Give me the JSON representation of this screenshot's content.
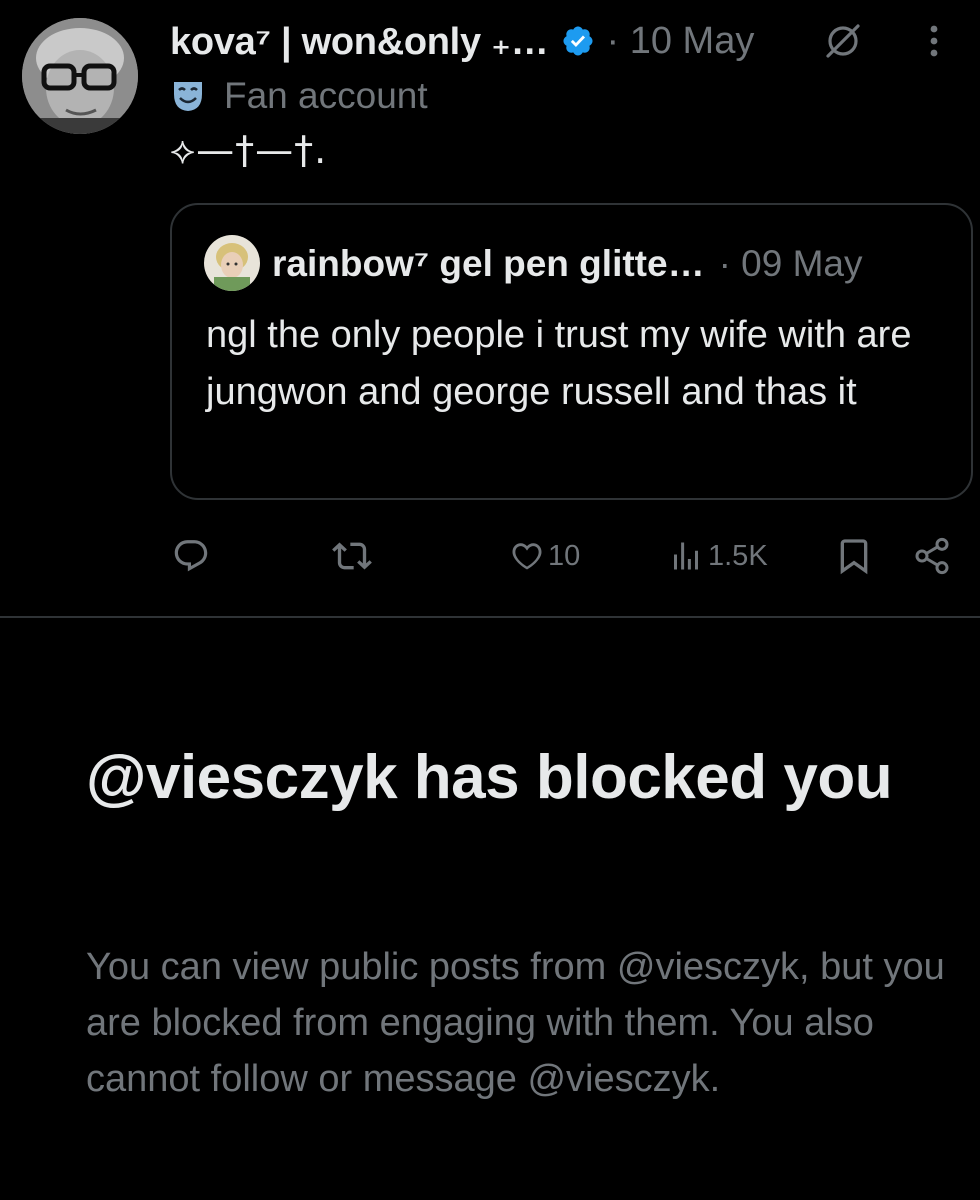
{
  "post": {
    "author_name": "kova⁷ | won&only ₊…",
    "post_time": "· 10 May",
    "label": "Fan account",
    "text": "⟡—†—†.",
    "quote": {
      "author_name": "rainbow⁷ gel pen glitte…",
      "post_time": "· 09 May",
      "text": "ngl the only people i trust my wife with are jungwon and george russell and thas it"
    },
    "actions": {
      "reply_icon": "reply-icon",
      "repost_icon": "repost-icon",
      "like_icon": "heart-icon",
      "like_count": "10",
      "views_icon": "views-icon",
      "view_count": "1.5K",
      "bookmark_icon": "bookmark-icon",
      "share_icon": "share-icon"
    }
  },
  "blocked": {
    "title": "@viesczyk has blocked you",
    "body": "You can view public posts from @viesczyk, but you are blocked from engaging with them. You also cannot follow or message @viesczyk."
  },
  "colors": {
    "background": "#000000",
    "primary_text": "#e7e9ea",
    "secondary_text": "#71767b",
    "border": "#2f3336",
    "verified": "#1d9bf0"
  }
}
